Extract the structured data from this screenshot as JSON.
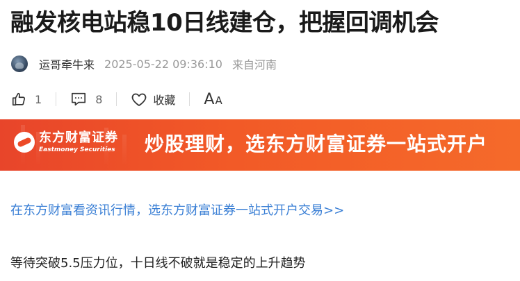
{
  "article": {
    "title": "融发核电站稳10日线建仓，把握回调机会"
  },
  "meta": {
    "author": "运哥牵牛来",
    "timestamp": "2025-05-22 09:36:10",
    "source": "来自河南"
  },
  "actions": {
    "like_count": "1",
    "comment_count": "8",
    "favorite_label": "收藏",
    "font_size_big": "A",
    "font_size_small": "A"
  },
  "banner": {
    "logo_cn": "东方财富证券",
    "logo_en": "Eastmoney Securities",
    "slogan": "炒股理财，选东方财富证券一站式开户",
    "colors": {
      "start": "#e8452a",
      "end": "#f56a2a"
    }
  },
  "content": {
    "promo_link": "在东方财富看资讯行情，选东方财富证券一站式开户交易>>",
    "paragraph_1": "等待突破5.5压力位，十日线不破就是稳定的上升趋势"
  },
  "icons": [
    "thumb-up-icon",
    "comment-icon",
    "heart-icon",
    "font-size-icon"
  ],
  "theme": {
    "link_color": "#3a7fd5",
    "meta_color": "#999999"
  }
}
